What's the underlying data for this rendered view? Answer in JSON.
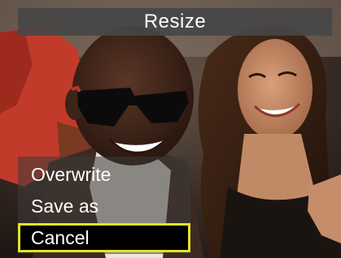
{
  "title": "Resize",
  "menu": {
    "items": [
      {
        "label": "Overwrite",
        "selected": false
      },
      {
        "label": "Save as",
        "selected": false
      },
      {
        "label": "Cancel",
        "selected": true
      }
    ]
  },
  "colors": {
    "title_bar": "#464646",
    "highlight_border": "#e4e12a",
    "highlight_fill": "#000000",
    "text": "#ffffff"
  }
}
